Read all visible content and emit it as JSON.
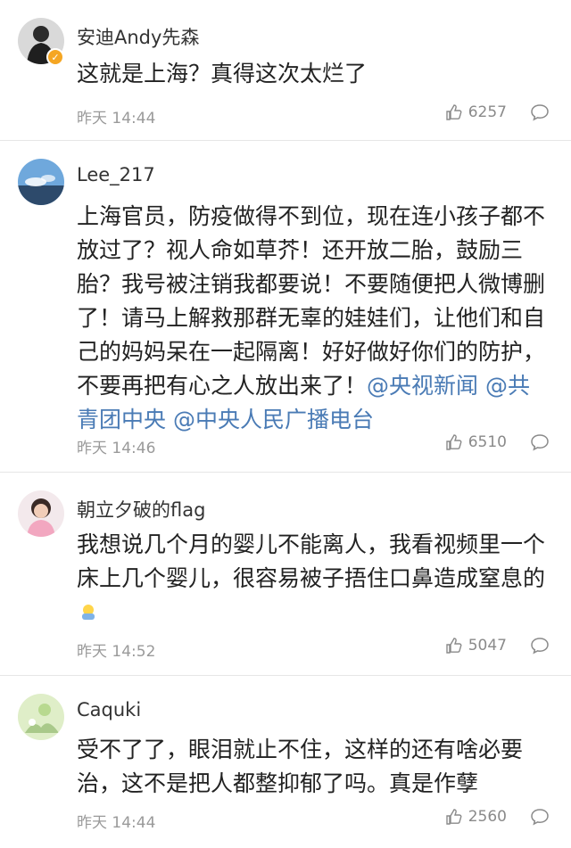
{
  "comments": [
    {
      "username": "安迪Andy先森",
      "verified_icon": "verified-badge-icon",
      "text": "这就是上海？真得这次太烂了",
      "time": "昨天 14:44",
      "likes": "6257"
    },
    {
      "username": "Lee_217",
      "text": "上海官员，防疫做得不到位，现在连小孩子都不放过了？视人命如草芥！还开放二胎，鼓励三胎？我号被注销我都要说！不要随便把人微博删了！请马上解救那群无辜的娃娃们，让他们和自己的妈妈呆在一起隔离！好好做好你们的防护，不要再把有心之人放出来了！",
      "mentions": [
        "@央视新闻",
        "@共青团中央",
        "@中央人民广播电台"
      ],
      "time": "昨天 14:46",
      "likes": "6510"
    },
    {
      "username": "朝立夕破的flag",
      "text": "我想说几个月的婴儿不能离人，我看视频里一个床上几个婴儿，很容易被子捂住口鼻造成窒息的",
      "emoji": "baby-emoji",
      "time": "昨天 14:52",
      "likes": "5047"
    },
    {
      "username": "Caquki",
      "text": "受不了了，眼泪就止不住，这样的还有啥必要治，这不是把人都整抑郁了吗。真是作孽",
      "time": "昨天 14:44",
      "likes": "2560"
    }
  ],
  "colors": {
    "mention": "#4a7bb5",
    "meta": "#9a9a9a",
    "divider": "#e6e6e6",
    "verified": "#f5a623"
  }
}
